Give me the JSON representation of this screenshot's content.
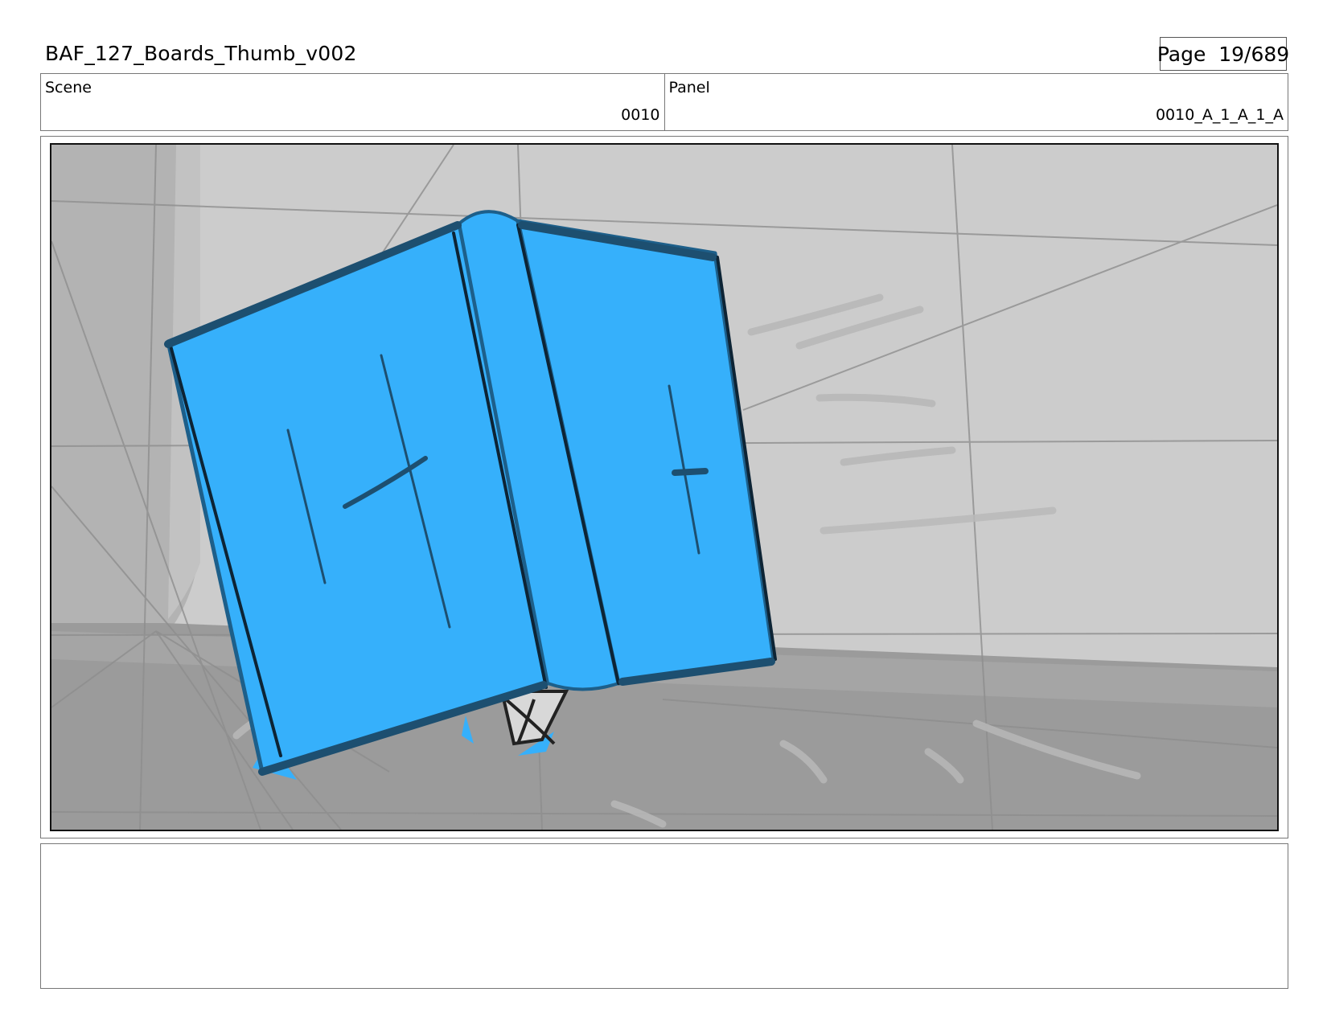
{
  "header": {
    "document_title": "BAF_127_Boards_Thumb_v002",
    "page_label": "Page",
    "page_value": "19/689"
  },
  "info": {
    "scene_label": "Scene",
    "scene_value": "0010",
    "panel_label": "Panel",
    "panel_value": "0010_A_1_A_1_A"
  },
  "panel_image": {
    "subject": "blue book falling open",
    "colors": {
      "book_blue": "#36b0fb",
      "book_edge": "#1d5f8a",
      "wall": "#cccccc",
      "wall_shadow": "#b3b3b3",
      "floor": "#9b9b9b"
    }
  },
  "notes": {
    "text": ""
  }
}
